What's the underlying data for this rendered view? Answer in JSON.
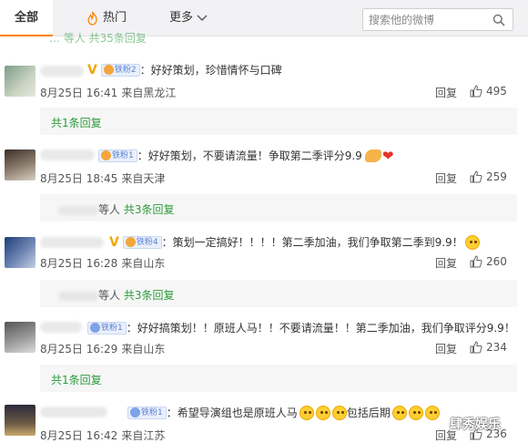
{
  "nav": {
    "tab_all": "全部",
    "tab_hot": "热门",
    "tab_more": "更多",
    "search_placeholder": "搜索他的微博"
  },
  "partial_reply_text": "…  等人 共35条回复",
  "comments": [
    {
      "badge": "铁粉2",
      "text": "：好好策划，珍惜情怀与口碑",
      "date": "8月25日 16:41",
      "from": "来自黑龙江",
      "reply_label": "回复",
      "likes": "495",
      "replies": {
        "text": "共1条回复",
        "who": ""
      }
    },
    {
      "badge": "铁粉1",
      "text": "：好好策划，不要请流量！争取第二季评分9.9",
      "date": "8月25日 18:45",
      "from": "来自天津",
      "reply_label": "回复",
      "likes": "259",
      "replies": {
        "text": "共3条回复",
        "who": "等人 "
      }
    },
    {
      "badge": "铁粉4",
      "text": "：策划一定搞好！！！！第二季加油，我们争取第二季到9.9！",
      "date": "8月25日 16:28",
      "from": "来自山东",
      "reply_label": "回复",
      "likes": "260",
      "replies": {
        "text": "共3条回复",
        "who": "等人 "
      }
    },
    {
      "badge": "铁粉1",
      "text": "：好好搞策划！！原班人马！！不要请流量！！第二季加油，我们争取评分9.9！",
      "date": "8月25日 16:29",
      "from": "来自山东",
      "reply_label": "回复",
      "likes": "234",
      "replies": {
        "text": "共1条回复",
        "who": ""
      }
    },
    {
      "badge": "铁粉1",
      "text": "：希望导演组也是原班人马",
      "text_tail": "包括后期",
      "date": "8月25日 16:42",
      "from": "来自江苏",
      "reply_label": "回复",
      "likes": "236"
    }
  ],
  "watermark": "肆秀娱乐",
  "colors": {
    "accent": "#ff8200",
    "reply_link": "#2d9b3c",
    "badge": "#5a7fd6"
  }
}
